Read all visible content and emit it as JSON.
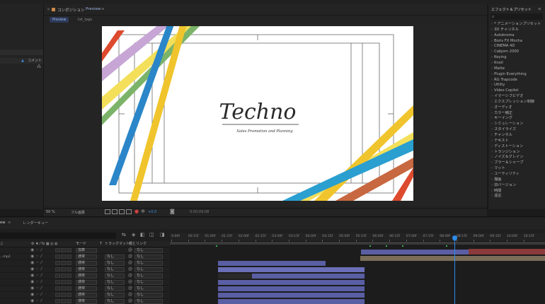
{
  "comp_panel": {
    "tab_label": "コンポジション",
    "tab_name": "Preview",
    "crumbs": [
      "Preview",
      "txt_logo"
    ]
  },
  "canvas_text": {
    "title": "Techno",
    "subtitle": "Sales Promotion and Planning"
  },
  "viewer_controls": {
    "zoom": "50 %",
    "resolution": "フル画質",
    "exposure": "+0.0",
    "timecode": "0;00;09;08"
  },
  "left_panel": {
    "comment_label": "コメント"
  },
  "effects_panel": {
    "title": "エフェクト＆プリセット",
    "items": [
      "* アニメーションプリセット",
      "3D チャンネル",
      "Autokroma",
      "Boris FX Mocha",
      "CINEMA 4D",
      "Cabjorn 2000",
      "Keying",
      "Knoll",
      "Matte",
      "Plugin Everything",
      "RG Trapcode",
      "Utility",
      "Video Copilot",
      "イマーシブビデオ",
      "エクスプレッション制御",
      "オーディオ",
      "カラー補正",
      "キーイング",
      "シミュレーション",
      "スタイライズ",
      "チャンネル",
      "テキスト",
      "ディストーション",
      "トランジション",
      "ノイズ＆グレイン",
      "ブラー＆シャープ",
      "マット",
      "ユーティリティ",
      "描画",
      "旧バージョン",
      "時間",
      "遠近"
    ]
  },
  "timeline": {
    "tab_label": "レンダーキュー",
    "col_mode": "モード",
    "col_trackmatte": "トラックマット",
    "col_parent": "親とリンク",
    "layers": [
      {
        "name": "",
        "mode": "加算",
        "track": "",
        "parent": "なし"
      },
      {
        "name": "...mp2",
        "mode": "通常",
        "track": "なし",
        "parent": "なし"
      },
      {
        "name": "",
        "mode": "通常",
        "track": "なし",
        "parent": "なし"
      },
      {
        "name": "",
        "mode": "通常",
        "track": "なし",
        "parent": "なし"
      },
      {
        "name": "",
        "mode": "通常",
        "track": "なし",
        "parent": "なし"
      },
      {
        "name": "",
        "mode": "通常",
        "track": "なし",
        "parent": "なし"
      },
      {
        "name": "",
        "mode": "通常",
        "track": "なし",
        "parent": "なし"
      },
      {
        "name": "",
        "mode": "通常",
        "track": "なし",
        "parent": "なし"
      },
      {
        "name": "",
        "mode": "通常",
        "track": "なし",
        "parent": "なし"
      }
    ],
    "ruler_ticks": [
      "0:00f",
      "00:15f",
      "01:00f",
      "01:15f",
      "02:00f",
      "02:15f",
      "03:00f",
      "03:15f",
      "04:00f",
      "04:15f",
      "05:00f",
      "05:15f",
      "06:00f",
      "06:15f",
      "07:00f",
      "07:15f",
      "08:00f",
      "08:15f",
      "09:00f",
      "09:15f",
      "10:00f",
      "10:15f"
    ]
  },
  "colors": {
    "accent": "#2d8ceb",
    "layer_bar": "#5a5ea3",
    "layer_bar_light": "#6b6fb8",
    "tan_bar": "#7a6e5a",
    "red_bar": "#8a3a3a"
  }
}
